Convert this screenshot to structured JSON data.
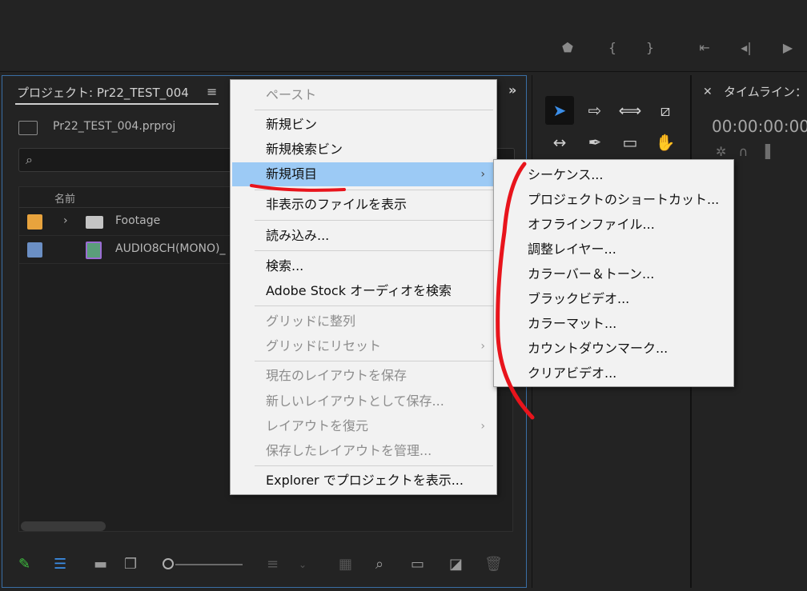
{
  "project_panel": {
    "tab_title": "プロジェクト: Pr22_TEST_004",
    "file_name": "Pr22_TEST_004.prproj",
    "column_name": "名前",
    "rows": [
      {
        "label": "Footage",
        "color": "#e8a33d",
        "kind": "folder"
      },
      {
        "label": "AUDIO8CH(MONO)_",
        "color": "#6b8fc4",
        "kind": "media"
      }
    ]
  },
  "context_menu": {
    "items": [
      {
        "label": "ペースト",
        "disabled": true
      },
      {
        "label": "新規ビン",
        "disabled": false
      },
      {
        "label": "新規検索ビン",
        "disabled": false
      },
      {
        "label": "新規項目",
        "disabled": false,
        "highlight": true,
        "submenu": true
      },
      {
        "label": "非表示のファイルを表示",
        "disabled": false
      },
      {
        "label": "読み込み...",
        "disabled": false
      },
      {
        "label": "検索...",
        "disabled": false
      },
      {
        "label": "Adobe Stock オーディオを検索",
        "disabled": false
      },
      {
        "label": "グリッドに整列",
        "disabled": true
      },
      {
        "label": "グリッドにリセット",
        "disabled": true,
        "submenu": true
      },
      {
        "label": "現在のレイアウトを保存",
        "disabled": true
      },
      {
        "label": "新しいレイアウトとして保存...",
        "disabled": true
      },
      {
        "label": "レイアウトを復元",
        "disabled": true,
        "submenu": true
      },
      {
        "label": "保存したレイアウトを管理...",
        "disabled": true
      },
      {
        "label": "Explorer でプロジェクトを表示...",
        "disabled": false
      }
    ],
    "arrow_glyph": "›"
  },
  "submenu": {
    "items": [
      "シーケンス...",
      "プロジェクトのショートカット...",
      "オフラインファイル...",
      "調整レイヤー...",
      "カラーバー＆トーン...",
      "ブラックビデオ...",
      "カラーマット...",
      "カウントダウンマーク...",
      "クリアビデオ..."
    ]
  },
  "timeline": {
    "title": "タイムライン：",
    "timecode": "00:00:00:00"
  },
  "colors": {
    "highlight": "#9ccaf5",
    "annotation_red": "#e8141c",
    "active_tool": "#3b8ee8"
  }
}
